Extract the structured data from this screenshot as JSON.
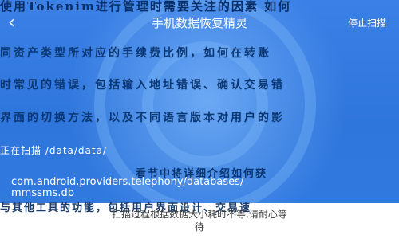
{
  "header": {
    "back_glyph": "‹",
    "title": "手机数据恢复精灵",
    "stop_label": "停止扫描"
  },
  "overlay": {
    "line1": "使用Tokenim进行管理时需要关注的因素 如何",
    "line2": "同资产类型所对应的手续费比例，如何在转账",
    "line3": "时常见的错误，包括输入地址错误、确认交易错",
    "line4": "界面的切换方法，以及不同语言版本对用户的影",
    "line5": "看节中将详细介绍如何获",
    "line6": "与其他工具的功能，包括用户界面设计、交易速"
  },
  "scan": {
    "status_prefix": "正在扫描 /data/data/",
    "path_line1": "com.android.providers.telephony/databases/",
    "path_line2": "mmssms.db"
  },
  "footer": {
    "hint_line1": "扫描过程根据数据大小耗时不等,请耐心等",
    "hint_line2": "待"
  },
  "colors": {
    "hero_blue": "#2f76dc",
    "overlay_text": "#0b3772",
    "white": "#ffffff"
  }
}
